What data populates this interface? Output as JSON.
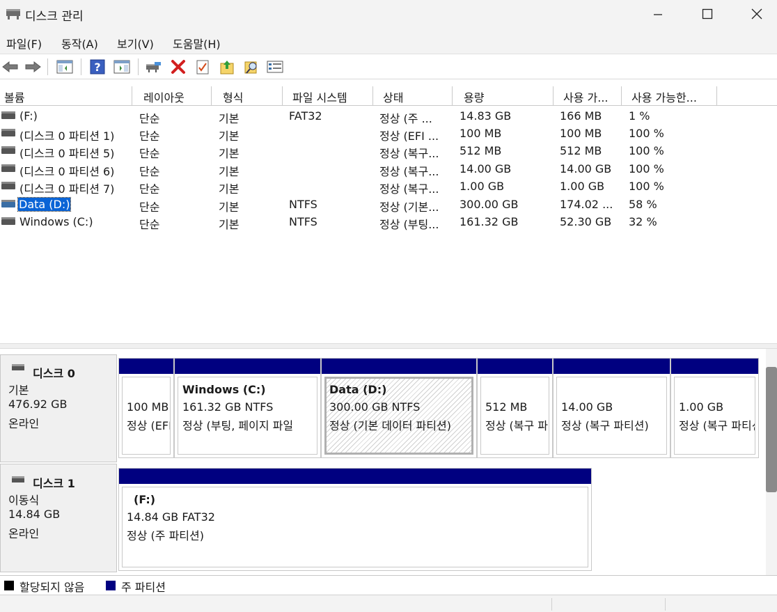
{
  "window": {
    "title": "디스크 관리"
  },
  "menu": [
    "파일(F)",
    "동작(A)",
    "보기(V)",
    "도움말(H)"
  ],
  "toolbar": [
    "back-icon",
    "forward-icon",
    "show-hide-console-tree-icon",
    "help-icon",
    "show-hide-action-pane-icon",
    "connect-drive-icon",
    "delete-icon",
    "properties-icon",
    "export-list-icon",
    "find-icon",
    "settings-icon"
  ],
  "columns": [
    "볼륨",
    "레이아웃",
    "형식",
    "파일 시스템",
    "상태",
    "용량",
    "사용 가...",
    "사용 가능한..."
  ],
  "volumes": [
    {
      "name": " (F:)",
      "layout": "단순",
      "type": "기본",
      "fs": "FAT32",
      "status": "정상 (주 ...",
      "capacity": "14.83 GB",
      "free": "166 MB",
      "pct": "1 %"
    },
    {
      "name": "(디스크 0 파티션 1)",
      "layout": "단순",
      "type": "기본",
      "fs": "",
      "status": "정상 (EFI ...",
      "capacity": "100 MB",
      "free": "100 MB",
      "pct": "100 %"
    },
    {
      "name": "(디스크 0 파티션 5)",
      "layout": "단순",
      "type": "기본",
      "fs": "",
      "status": "정상 (복구...",
      "capacity": "512 MB",
      "free": "512 MB",
      "pct": "100 %"
    },
    {
      "name": "(디스크 0 파티션 6)",
      "layout": "단순",
      "type": "기본",
      "fs": "",
      "status": "정상 (복구...",
      "capacity": "14.00 GB",
      "free": "14.00 GB",
      "pct": "100 %"
    },
    {
      "name": "(디스크 0 파티션 7)",
      "layout": "단순",
      "type": "기본",
      "fs": "",
      "status": "정상 (복구...",
      "capacity": "1.00 GB",
      "free": "1.00 GB",
      "pct": "100 %"
    },
    {
      "name": "Data (D:)",
      "layout": "단순",
      "type": "기본",
      "fs": "NTFS",
      "status": "정상 (기본...",
      "capacity": "300.00 GB",
      "free": "174.02 ...",
      "pct": "58 %"
    },
    {
      "name": "Windows (C:)",
      "layout": "단순",
      "type": "기본",
      "fs": "NTFS",
      "status": "정상 (부팅...",
      "capacity": "161.32 GB",
      "free": "52.30 GB",
      "pct": "32 %"
    }
  ],
  "disks": [
    {
      "name": "디스크 0",
      "kind": "기본",
      "size": "476.92 GB",
      "state": "온라인",
      "partitions": [
        {
          "title": "",
          "line1": "100 MB",
          "line2": "정상 (EFI 시스템 파티션)"
        },
        {
          "title": "Windows  (C:)",
          "line1": "161.32 GB NTFS",
          "line2": "정상 (부팅, 페이지 파일"
        },
        {
          "title": "Data  (D:)",
          "line1": "300.00 GB NTFS",
          "line2": "정상 (기본 데이터 파티션)"
        },
        {
          "title": "",
          "line1": "512 MB",
          "line2": "정상 (복구 파티션)"
        },
        {
          "title": "",
          "line1": "14.00 GB",
          "line2": "정상 (복구 파티션)"
        },
        {
          "title": "",
          "line1": "1.00 GB",
          "line2": "정상 (복구 파티션)"
        }
      ]
    },
    {
      "name": "디스크 1",
      "kind": "이동식",
      "size": "14.84 GB",
      "state": "온라인",
      "partitions": [
        {
          "title": "(F:)",
          "line1": "14.84 GB FAT32",
          "line2": "정상 (주 파티션)"
        }
      ]
    }
  ],
  "legend": [
    {
      "label": "할당되지 않음",
      "color": "#000000"
    },
    {
      "label": "주 파티션",
      "color": "#000080"
    }
  ]
}
